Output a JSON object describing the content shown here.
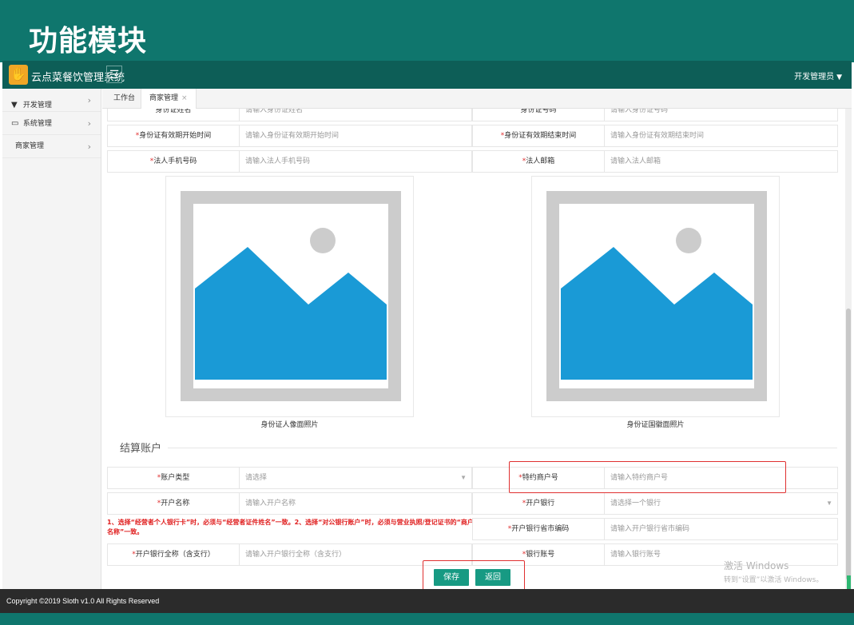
{
  "slide": {
    "title": "功能模块"
  },
  "app": {
    "name": "云点菜餐饮管理系统",
    "logo_glyph": "✋",
    "menu_toggle": "☰",
    "user": "开发管理员",
    "user_caret": "▼"
  },
  "sidebar": {
    "items": [
      {
        "icon": "filter-icon",
        "glyph": "▼",
        "label": "开发管理"
      },
      {
        "icon": "monitor-icon",
        "glyph": "▭",
        "label": "系统管理"
      },
      {
        "label": "商家管理"
      }
    ],
    "chevron": "›"
  },
  "tabs": [
    {
      "label": "工作台"
    },
    {
      "label": "商家管理",
      "close": "×"
    }
  ],
  "form_top": {
    "partial_left": {
      "label": "身份证姓名",
      "placeholder": "请输入身份证姓名"
    },
    "partial_right": {
      "label": "身份证号码",
      "placeholder": "请输入身份证号码"
    },
    "id_start": {
      "label": "身份证有效期开始时间",
      "placeholder": "请输入身份证有效期开始时间"
    },
    "id_end": {
      "label": "身份证有效期结束时间",
      "placeholder": "请输入身份证有效期结束时间"
    },
    "legal_phone": {
      "label": "法人手机号码",
      "placeholder": "请输入法人手机号码"
    },
    "legal_email": {
      "label": "法人邮箱",
      "placeholder": "请输入法人邮箱"
    }
  },
  "photos": {
    "front_caption": "身份证人像面照片",
    "back_caption": "身份证国徽面照片"
  },
  "settlement": {
    "section_title": "结算账户",
    "account_type": {
      "label": "账户类型",
      "placeholder": "请选择"
    },
    "merchant_no": {
      "label": "特约商户号",
      "placeholder": "请输入特约商户号"
    },
    "account_name": {
      "label": "开户名称",
      "placeholder": "请输入开户名称"
    },
    "bank": {
      "label": "开户银行",
      "placeholder": "请选择一个银行"
    },
    "bank_city": {
      "label": "开户银行省市编码",
      "placeholder": "请输入开户银行省市编码"
    },
    "bank_full": {
      "label": "开户银行全称（含支行）",
      "placeholder": "请输入开户银行全称（含支行）"
    },
    "bank_account": {
      "label": "银行账号",
      "placeholder": "请输入银行账号"
    },
    "hint": "1、选择“经营者个人银行卡”时，必须与“经营者证件姓名”一致。2、选择“对公银行账户”时，必须与营业执照/登记证书的“商户名称”一致。",
    "req": "*",
    "select_arrow": "▼"
  },
  "actions": {
    "save": "保存",
    "back": "返回"
  },
  "footer": {
    "copyright": "Copyright ©2019 Sloth v1.0 All Rights Reserved"
  },
  "watermark": {
    "line1": "激活 Windows",
    "line2": "转到“设置”以激活 Windows。"
  },
  "colors": {
    "brand": "#0f766d",
    "header": "#0d5e57",
    "button": "#179a83",
    "required": "#e03030",
    "image_blue": "#1a9ad6"
  }
}
